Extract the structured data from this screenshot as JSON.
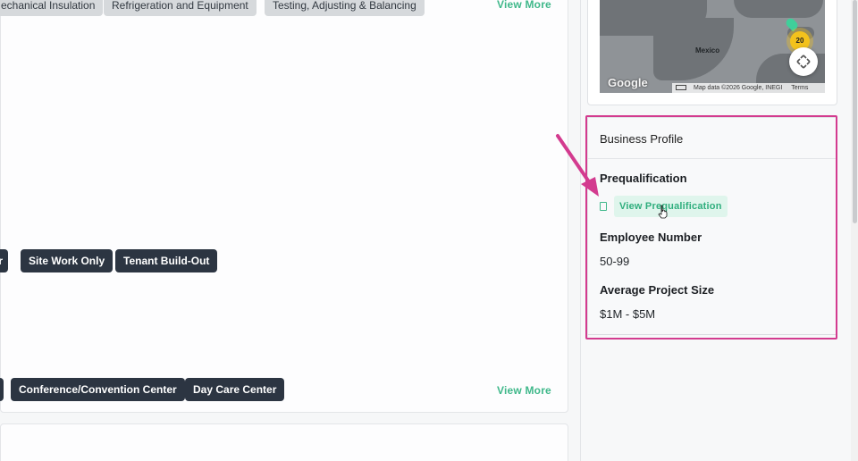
{
  "trade_chips": [
    "echanical Insulation",
    "Refrigeration and Equipment",
    "Testing, Adjusting & Balancing"
  ],
  "view_more_top": "View More",
  "work_chips": [
    "ir",
    "Site Work Only",
    "Tenant Build-Out"
  ],
  "market_chips": [
    "",
    "Conference/Convention Center",
    "Day Care Center"
  ],
  "view_more_bottom": "View More",
  "map": {
    "country_label": "Mexico",
    "logo": "Google",
    "attribution": "Map data ©2026 Google, INEGI",
    "terms": "Terms",
    "cluster_count": "20"
  },
  "business_profile": {
    "title": "Business Profile",
    "prequal_label": "Prequalification",
    "prequal_button": "View Prequalification",
    "employee_label": "Employee Number",
    "employee_value": "50-99",
    "project_size_label": "Average Project Size",
    "project_size_value": "$1M - $5M"
  },
  "colors": {
    "accent": "#3fb88a",
    "highlight": "#d33b8f",
    "chip_dark": "#2c3542"
  }
}
